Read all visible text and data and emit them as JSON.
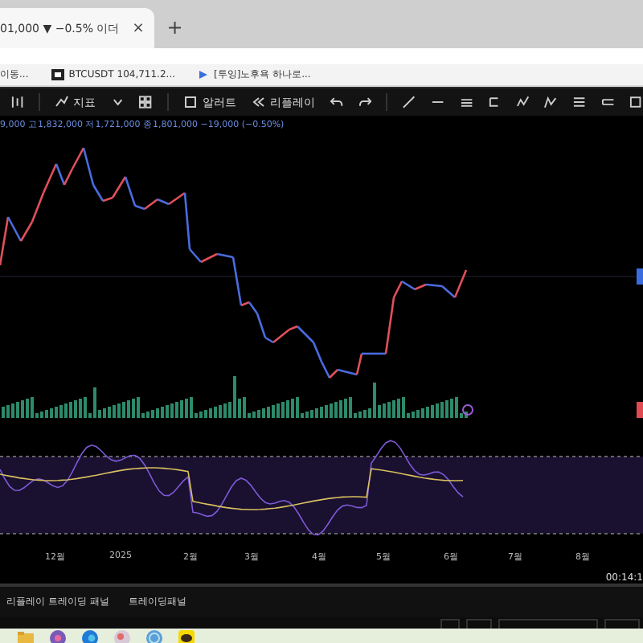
{
  "browser": {
    "tab": {
      "title": "01,000 ▼ −0.5% 이더",
      "close": "×"
    },
    "new_tab": "+",
    "bookmarks": [
      {
        "label": "이동..."
      },
      {
        "label": "BTCUSDT 104,711.2..."
      },
      {
        "label": "[투잉]노후욕 하나로..."
      }
    ]
  },
  "toolbar": {
    "buttons": [
      {
        "label": "지표"
      },
      {
        "label": "알러트"
      },
      {
        "label": "리플레이"
      }
    ]
  },
  "legend": "9,000 고1,832,000 저1,721,000 종1,801,000 −19,000 (−0.50%)",
  "time_axis": [
    "12월",
    "2025",
    "2월",
    "3월",
    "4월",
    "5월",
    "6월",
    "7월",
    "8월"
  ],
  "clock": "00:14:1",
  "bottom_tabs": [
    {
      "label": "리플레이 트레이딩 패널"
    },
    {
      "label": "트레이딩패널"
    }
  ]
}
